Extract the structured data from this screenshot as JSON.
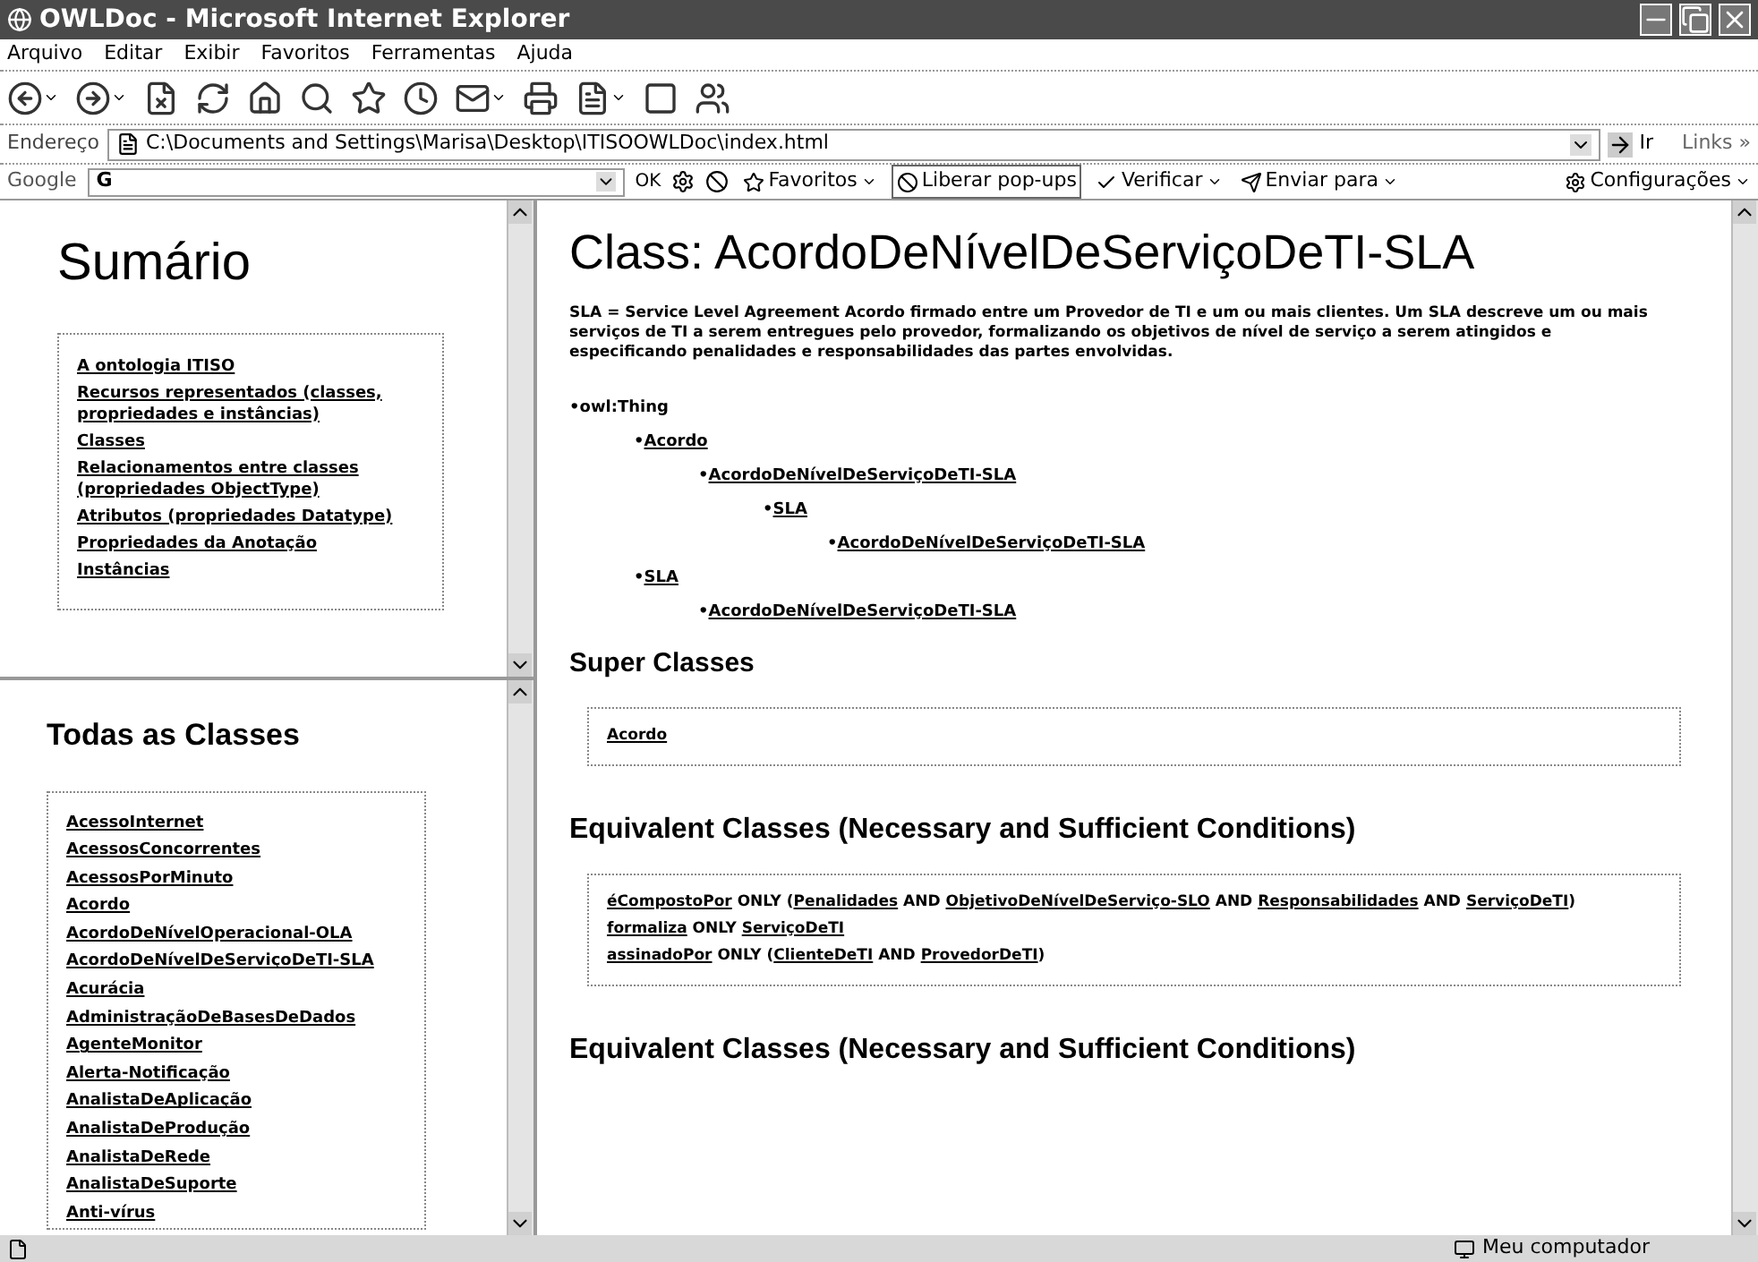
{
  "window": {
    "title": "OWLDoc - Microsoft Internet Explorer"
  },
  "menu": [
    "Arquivo",
    "Editar",
    "Exibir",
    "Favoritos",
    "Ferramentas",
    "Ajuda"
  ],
  "address_bar": {
    "label": "Endereço",
    "value": "C:\\Documents and Settings\\Marisa\\Desktop\\ITISOOWLDoc\\index.html",
    "go": "Ir",
    "links": "Links »"
  },
  "google_bar": {
    "label": "Google",
    "logo": "G",
    "ok": "OK",
    "buttons": [
      {
        "label": "Favoritos",
        "kind": "menu"
      },
      {
        "label": "Liberar pop-ups",
        "kind": "toggle"
      },
      {
        "label": "Verificar",
        "kind": "menu"
      },
      {
        "label": "Enviar para",
        "kind": "menu"
      }
    ],
    "settings": "Configurações"
  },
  "summary": {
    "title": "Sumário",
    "links": [
      "A ontologia ITISO",
      "Recursos representados (classes, propriedades e instâncias)",
      "Classes",
      "Relacionamentos entre classes (propriedades ObjectType)",
      "Atributos (propriedades Datatype)",
      "Propriedades da Anotação",
      "Instâncias"
    ]
  },
  "all_classes": {
    "title": "Todas as Classes",
    "links": [
      "AcessoInternet",
      "AcessosConcorrentes",
      "AcessosPorMinuto",
      "Acordo",
      "AcordoDeNívelOperacional-OLA",
      "AcordoDeNívelDeServiçoDeTI-SLA",
      "Acurácia",
      "AdministraçãoDeBasesDeDados",
      "AgenteMonitor",
      "Alerta-Notificação",
      "AnalistaDeAplicação",
      "AnalistaDeProdução",
      "AnalistaDeRede",
      "AnalistaDeSuporte",
      "Anti-vírus"
    ]
  },
  "main": {
    "title": "Class: AcordoDeNívelDeServiçoDeTI-SLA",
    "description": "SLA = Service Level Agreement Acordo firmado entre um Provedor de TI e um ou mais clientes. Um SLA descreve um ou mais serviços de TI a serem entregues pelo provedor, formalizando os objetivos de nível de serviço a serem atingidos e especificando penalidades e responsabilidades das partes envolvidas.",
    "tree": [
      {
        "marker": "•",
        "label": "owl:Thing",
        "link": false,
        "children": [
          {
            "marker": "•",
            "label": "Acordo",
            "link": true,
            "children": [
              {
                "marker": "•",
                "label": "AcordoDeNívelDeServiçoDeTI-SLA",
                "link": true,
                "children": [
                  {
                    "marker": "•",
                    "label": "SLA",
                    "link": true,
                    "children": [
                      {
                        "marker": "•",
                        "label": "AcordoDeNívelDeServiçoDeTI-SLA",
                        "link": true
                      }
                    ]
                  }
                ]
              }
            ]
          },
          {
            "marker": "•",
            "label": "SLA",
            "link": true,
            "children": [
              {
                "marker": "•",
                "label": "AcordoDeNívelDeServiçoDeTI-SLA",
                "link": true
              }
            ]
          }
        ]
      }
    ],
    "sections": [
      {
        "heading": "Super Classes",
        "lines": [
          [
            {
              "text": "Acordo",
              "link": true
            }
          ]
        ]
      },
      {
        "heading": "Equivalent Classes (Necessary and Sufficient Conditions)",
        "lines": [
          [
            {
              "text": "éCompostoPor",
              "link": true
            },
            {
              "text": " ONLY (",
              "link": false
            },
            {
              "text": "Penalidades",
              "link": true
            },
            {
              "text": " AND ",
              "link": false
            },
            {
              "text": "ObjetivoDeNívelDeServiço-SLO",
              "link": true
            },
            {
              "text": " AND ",
              "link": false
            },
            {
              "text": "Responsabilidades",
              "link": true
            },
            {
              "text": " AND ",
              "link": false
            },
            {
              "text": "ServiçoDeTI",
              "link": true
            },
            {
              "text": ")",
              "link": false
            }
          ],
          [
            {
              "text": "formaliza",
              "link": true
            },
            {
              "text": " ONLY ",
              "link": false
            },
            {
              "text": "ServiçoDeTI",
              "link": true
            }
          ],
          [
            {
              "text": "assinadoPor",
              "link": true
            },
            {
              "text": " ONLY (",
              "link": false
            },
            {
              "text": "ClienteDeTI",
              "link": true
            },
            {
              "text": " AND ",
              "link": false
            },
            {
              "text": "ProvedorDeTI",
              "link": true
            },
            {
              "text": ")",
              "link": false
            }
          ]
        ]
      },
      {
        "heading": "Equivalent Classes (Necessary and Sufficient Conditions)"
      }
    ]
  },
  "status_bar": {
    "zone": "Meu computador"
  }
}
